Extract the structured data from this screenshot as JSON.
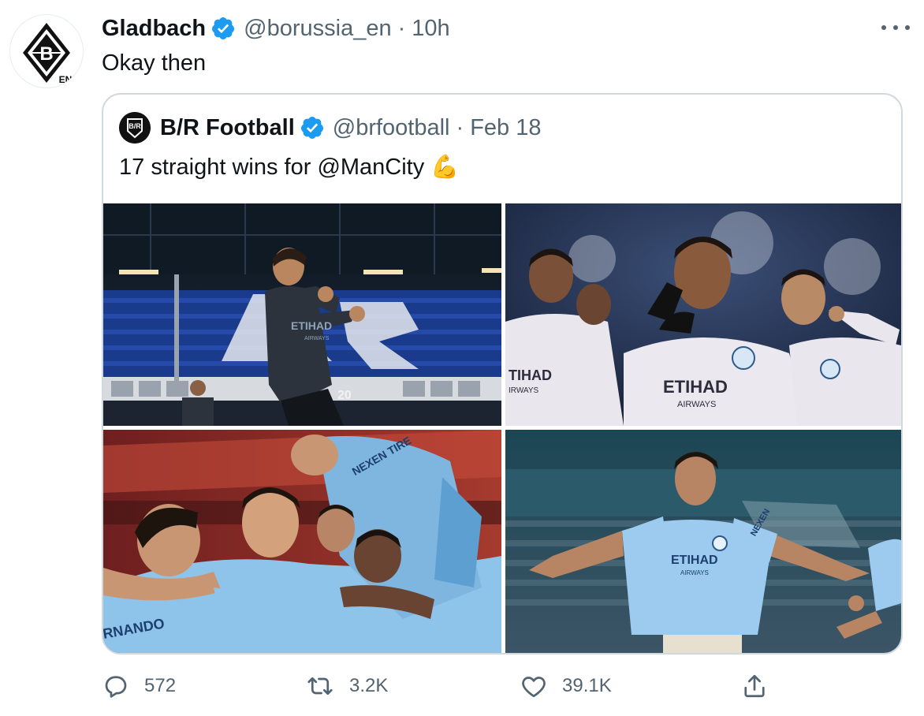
{
  "tweet": {
    "author": {
      "display_name": "Gladbach",
      "handle": "@borussia_en",
      "separator": "·",
      "time": "10h",
      "avatar_badge": "EN",
      "avatar_letter": "B"
    },
    "text": "Okay then",
    "more_icon": "more-dots-icon"
  },
  "quoted_tweet": {
    "author": {
      "display_name": "B/R Football",
      "handle": "@brfootball",
      "separator": "·",
      "date": "Feb 18",
      "avatar_letters": "B/R"
    },
    "text": "17 straight wins for @ManCity 💪",
    "photos": [
      {
        "jersey_text": "ETIHAD",
        "jersey_sub": "AIRWAYS",
        "number": "20"
      },
      {
        "jersey_text": "ETIHAD",
        "jersey_sub": "AIRWAYS",
        "left_text": "TIHAD",
        "left_sub": "IRWAYS"
      },
      {
        "jersey_text": "NEXEN TIRE",
        "name_text": "RNANDO"
      },
      {
        "jersey_text": "ETIHAD",
        "jersey_sub": "AIRWAYS",
        "sleeve_text": "NEXEN"
      }
    ]
  },
  "actions": {
    "reply_count": "572",
    "retweet_count": "3.2K",
    "like_count": "39.1K"
  },
  "colors": {
    "verified": "#1d9bf0",
    "secondary_text": "#536471",
    "border": "#cfd9de",
    "city_blue": "#8ec3ea"
  }
}
